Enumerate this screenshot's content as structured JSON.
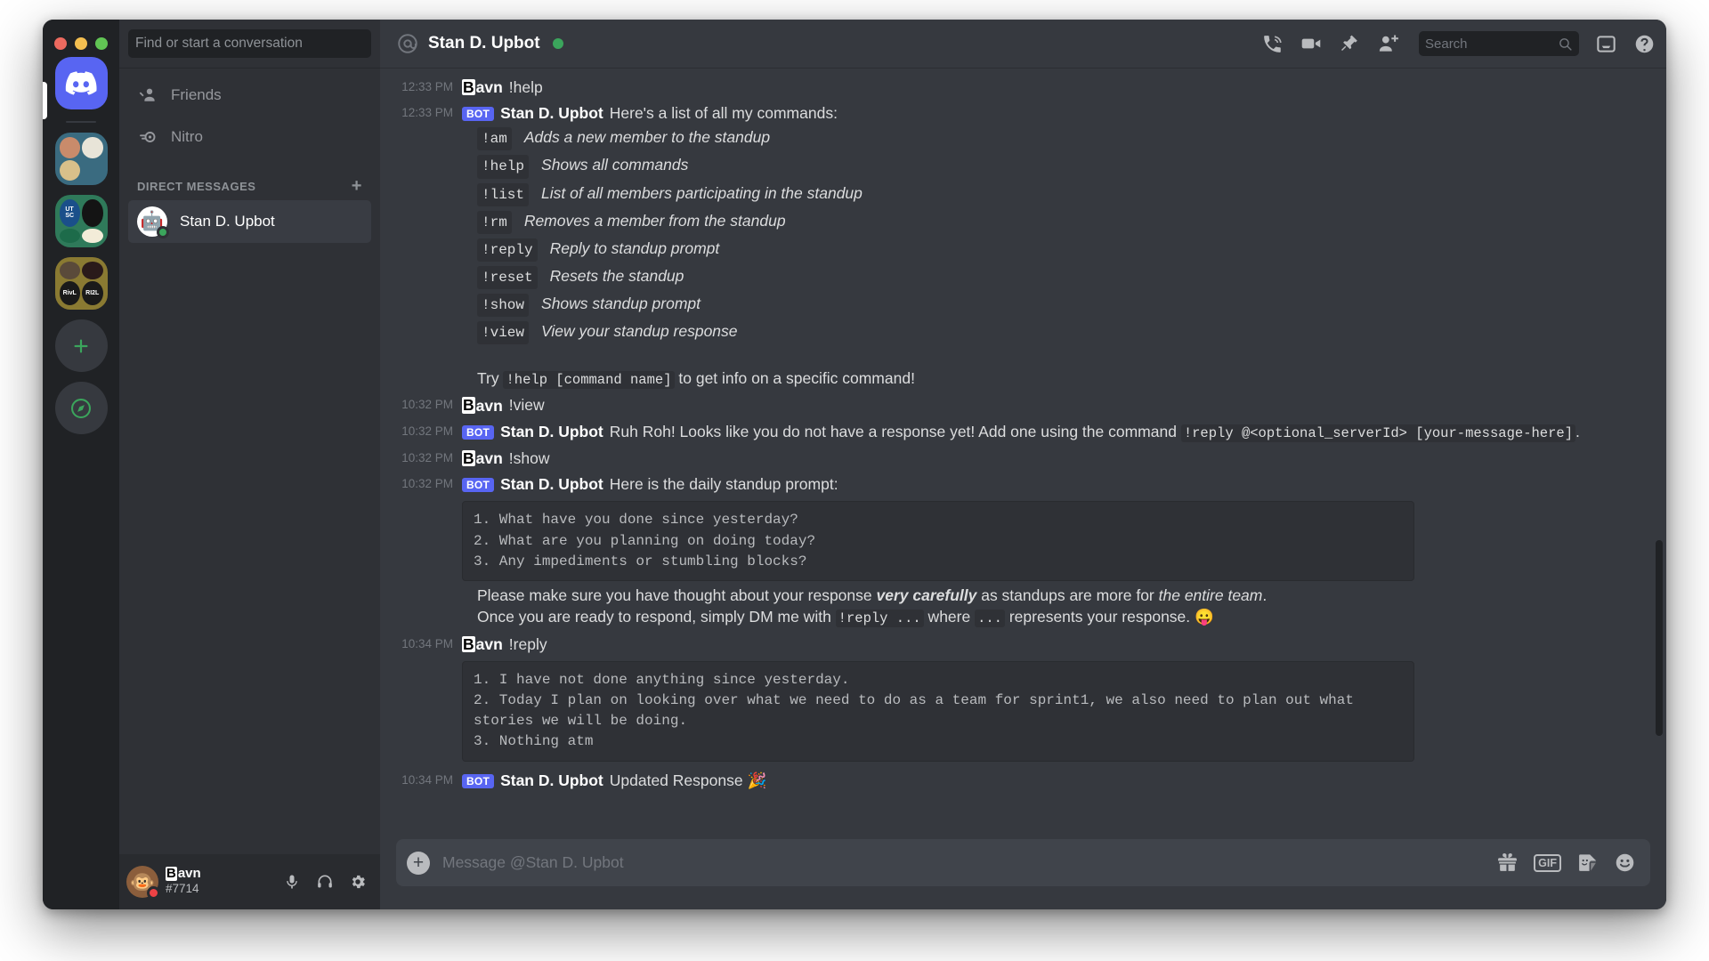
{
  "window": {
    "traffic_lights": [
      "close",
      "minimize",
      "maximize"
    ]
  },
  "server_rail": {
    "home_label": "Discord",
    "add_label": "+",
    "explore_label": "compass",
    "folders": [
      {
        "name": "server-folder-1",
        "color": "#3a6b80",
        "cells": [
          "",
          "",
          ""
        ]
      },
      {
        "name": "server-folder-2",
        "color": "#2f7a5a",
        "cells": [
          "UTSC",
          "",
          "",
          ""
        ]
      },
      {
        "name": "server-folder-3",
        "color": "#8a7a32",
        "cells": [
          "",
          "",
          "RivL",
          "RI2L"
        ]
      }
    ]
  },
  "sidebar": {
    "search_placeholder": "Find or start a conversation",
    "items": [
      {
        "label": "Friends",
        "icon": "friends-icon"
      },
      {
        "label": "Nitro",
        "icon": "nitro-icon"
      }
    ],
    "dm_header": "DIRECT MESSAGES",
    "dm_add": "+",
    "dms": [
      {
        "name": "Stan D. Upbot",
        "status": "online",
        "avatar": "robot"
      }
    ]
  },
  "user_panel": {
    "name_prefix": "B",
    "name_rest": "avn",
    "tag": "#7714",
    "status": "dnd",
    "buttons": [
      {
        "name": "mute-button",
        "icon": "microphone-icon"
      },
      {
        "name": "deafen-button",
        "icon": "headphones-icon"
      },
      {
        "name": "settings-button",
        "icon": "gear-icon"
      }
    ]
  },
  "chat_header": {
    "at_icon": "at-icon",
    "title": "Stan D. Upbot",
    "status": "online",
    "icons": [
      {
        "name": "start-call-button",
        "icon": "phone-call-icon"
      },
      {
        "name": "start-video-call-button",
        "icon": "video-camera-icon"
      },
      {
        "name": "pinned-messages-button",
        "icon": "pin-icon"
      },
      {
        "name": "add-friends-button",
        "icon": "add-person-icon"
      }
    ],
    "search_placeholder": "Search",
    "inbox_icon": "inbox-icon",
    "help_icon": "help-icon"
  },
  "messages": {
    "m1": {
      "time": "12:33 PM",
      "author_prefix": "B",
      "author_rest": "avn",
      "text": "!help"
    },
    "m2": {
      "time": "12:33 PM",
      "bot_tag": "BOT",
      "author": "Stan D. Upbot",
      "text": "Here's a list of all my commands:",
      "commands": [
        {
          "cmd": "!am",
          "desc": "Adds a new member to the standup"
        },
        {
          "cmd": "!help",
          "desc": "Shows all commands"
        },
        {
          "cmd": "!list",
          "desc": "List of all members participating in the standup"
        },
        {
          "cmd": "!rm",
          "desc": "Removes a member from the standup"
        },
        {
          "cmd": "!reply",
          "desc": "Reply to standup prompt"
        },
        {
          "cmd": "!reset",
          "desc": "Resets the standup"
        },
        {
          "cmd": "!show",
          "desc": "Shows standup prompt"
        },
        {
          "cmd": "!view",
          "desc": "View your standup response"
        }
      ],
      "try_prefix": "Try ",
      "try_code": "!help [command name]",
      "try_suffix": " to get info on a specific command!"
    },
    "m3": {
      "time": "10:32 PM",
      "author_prefix": "B",
      "author_rest": "avn",
      "text": "!view"
    },
    "m4": {
      "time": "10:32 PM",
      "bot_tag": "BOT",
      "author": "Stan D. Upbot",
      "text_before": "Ruh Roh! Looks like you do not have a response yet! Add one using the command ",
      "code1": "!reply @<optional_serverId> [your-message-here]",
      "text_after": "."
    },
    "m5": {
      "time": "10:32 PM",
      "author_prefix": "B",
      "author_rest": "avn",
      "text": "!show"
    },
    "m6": {
      "time": "10:32 PM",
      "bot_tag": "BOT",
      "author": "Stan D. Upbot",
      "text": "Here is the daily standup prompt:",
      "codeblock": "1. What have you done since yesterday?\n2. What are you planning on doing today?\n3. Any impediments or stumbling blocks?",
      "line1_a": "Please make sure you have thought about your response ",
      "line1_bold": "very carefully",
      "line1_b": " as standups are more for ",
      "line1_italic": "the entire team",
      "line1_c": ".",
      "line2_a": "Once you are ready to respond, simply DM me with ",
      "line2_code1": "!reply ...",
      "line2_b": " where ",
      "line2_code2": "...",
      "line2_c": " represents your response. ",
      "line2_emoji": "😛"
    },
    "m7": {
      "time": "10:34 PM",
      "author_prefix": "B",
      "author_rest": "avn",
      "text": "!reply"
    },
    "m8": {
      "time": "",
      "codeblock": "1. I have not done anything since yesterday.\n2. Today I plan on looking over what we need to do as a team for sprint1, we also need to plan out what stories we will be doing.\n3. Nothing atm"
    },
    "m9": {
      "time": "10:34 PM",
      "bot_tag": "BOT",
      "author": "Stan D. Upbot",
      "text": "Updated Response ",
      "emoji": "🎉"
    }
  },
  "input": {
    "plus": "+",
    "placeholder": "Message @Stan D. Upbot",
    "icons": [
      {
        "name": "gift-button",
        "icon": "gift-icon"
      },
      {
        "name": "gif-button",
        "label": "GIF"
      },
      {
        "name": "sticker-button",
        "icon": "sticker-icon"
      },
      {
        "name": "emoji-button",
        "icon": "emoji-icon"
      }
    ]
  },
  "colors": {
    "brand": "#5865f2",
    "online": "#3ba55c",
    "dnd": "#ed4245",
    "bg_main": "#36393f",
    "bg_sidebar": "#2f3136",
    "bg_rail": "#202225"
  }
}
